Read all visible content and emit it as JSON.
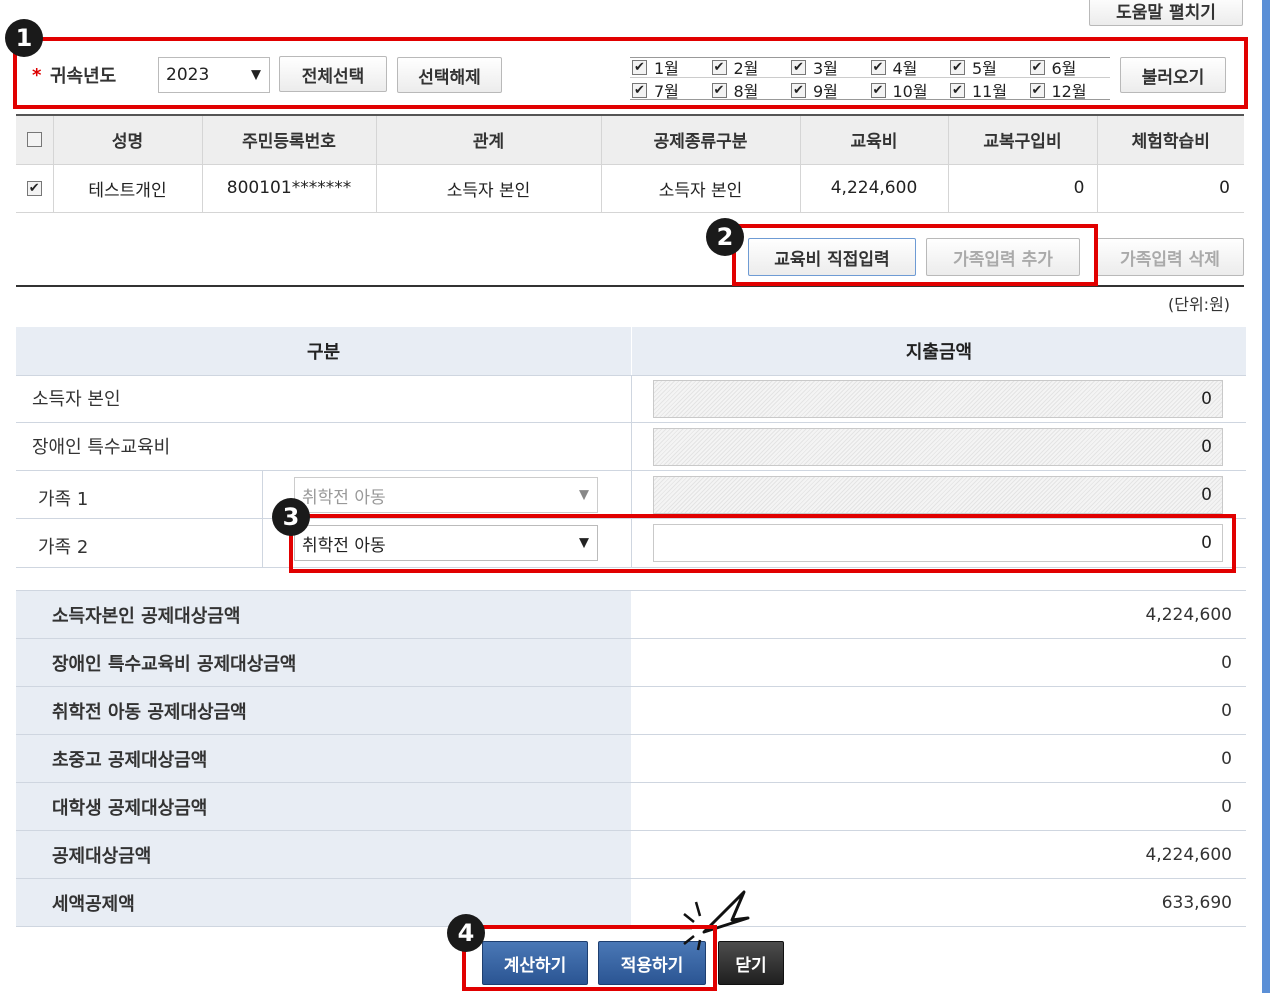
{
  "top_button": "도움말 펼치기",
  "filter": {
    "required_mark": "*",
    "year_label": "귀속년도",
    "year_value": "2023",
    "select_all": "전체선택",
    "deselect": "선택해제",
    "months": [
      "1월",
      "2월",
      "3월",
      "4월",
      "5월",
      "6월",
      "7월",
      "8월",
      "9월",
      "10월",
      "11월",
      "12월"
    ],
    "load_button": "불러오기"
  },
  "people_table": {
    "headers": [
      "성명",
      "주민등록번호",
      "관계",
      "공제종류구분",
      "교육비",
      "교복구입비",
      "체험학습비"
    ],
    "rows": [
      {
        "name": "테스트개인",
        "rrn": "800101*******",
        "relation": "소득자 본인",
        "deduction_type": "소득자 본인",
        "education": "4,224,600",
        "uniform": "0",
        "field_trip": "0"
      }
    ]
  },
  "actions": {
    "direct_input": "교육비 직접입력",
    "add_family": "가족입력 추가",
    "delete_family": "가족입력 삭제"
  },
  "unit_label": "(단위:원)",
  "input_section": {
    "col_category": "구분",
    "col_amount": "지출금액",
    "rows": [
      {
        "label": "소득자 본인",
        "amount": "0"
      },
      {
        "label": "장애인 특수교육비",
        "amount": "0"
      },
      {
        "label": "가족 1",
        "select": "취학전 아동",
        "amount": "0"
      },
      {
        "label": "가족 2",
        "select": "취학전 아동",
        "amount": "0"
      }
    ]
  },
  "summary": [
    {
      "label": "소득자본인 공제대상금액",
      "value": "4,224,600"
    },
    {
      "label": "장애인 특수교육비 공제대상금액",
      "value": "0"
    },
    {
      "label": "취학전 아동 공제대상금액",
      "value": "0"
    },
    {
      "label": "초중고 공제대상금액",
      "value": "0"
    },
    {
      "label": "대학생 공제대상금액",
      "value": "0"
    },
    {
      "label": "공제대상금액",
      "value": "4,224,600"
    },
    {
      "label": "세액공제액",
      "value": "633,690"
    }
  ],
  "bottom_buttons": {
    "calculate": "계산하기",
    "apply": "적용하기",
    "close": "닫기"
  },
  "badges": [
    "1",
    "2",
    "3",
    "4"
  ],
  "colors": {
    "annotation_red": "#e10000",
    "button_blue": "#2b5593",
    "header_bg": "#e8edf4"
  }
}
